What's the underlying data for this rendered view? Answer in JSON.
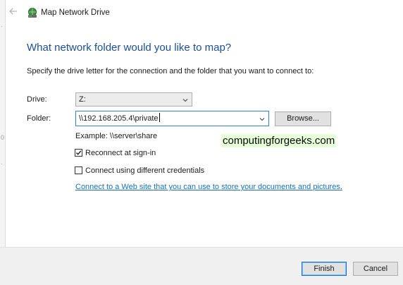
{
  "window": {
    "title": "Map Network Drive"
  },
  "page": {
    "heading": "What network folder would you like to map?",
    "instruction": "Specify the drive letter for the connection and the folder that you want to connect to:"
  },
  "drive": {
    "label": "Drive:",
    "value": "Z:"
  },
  "folder": {
    "label": "Folder:",
    "value": "\\\\192.168.205.4\\private",
    "browse_label": "Browse...",
    "example": "Example: \\\\server\\share"
  },
  "options": {
    "reconnect_label": "Reconnect at sign-in",
    "reconnect_checked": true,
    "credentials_label": "Connect using different credentials",
    "credentials_checked": false
  },
  "link_text": "Connect to a Web site that you can use to store your documents and pictures",
  "link_suffix": ".",
  "watermark": "computingforgeeks.com",
  "buttons": {
    "finish": "Finish",
    "cancel": "Cancel"
  },
  "colors": {
    "heading": "#1d4f91",
    "link": "#1a6fb8",
    "focus_border": "#2f7fd6"
  }
}
